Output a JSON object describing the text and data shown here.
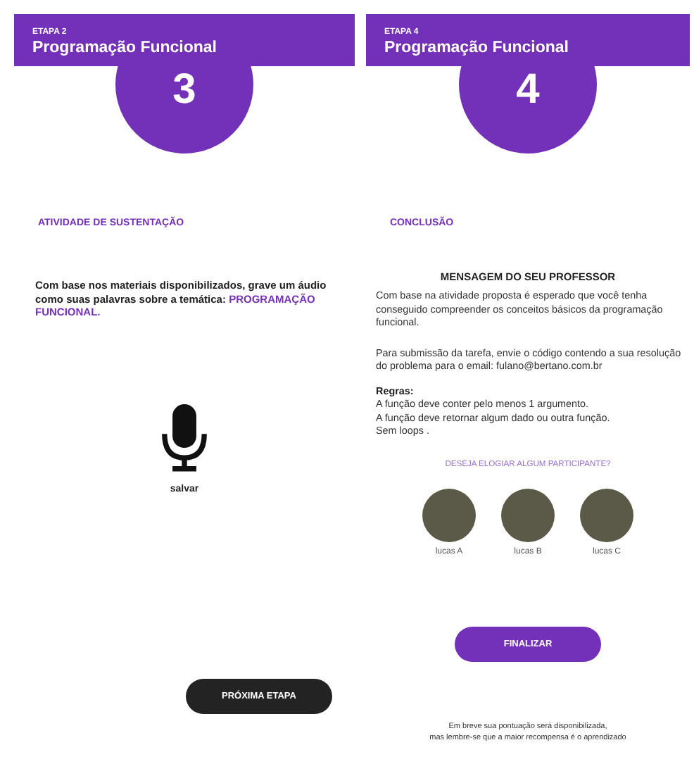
{
  "activity_screen": {
    "stage": "ETAPA 2",
    "title": "Programação Funcional",
    "step": "3",
    "section_title": "ATIVIDADE DE SUSTENTAÇÃO",
    "prompt": "Com base nos materiais disponibilizados, grave um áudio como suas palavras sobre a temática:",
    "prompt_highlight": "PROGRAMAÇÃO FUNCIONAL.",
    "record_label": "salvar",
    "next_button": "PRÓXIMA ETAPA"
  },
  "conclusion_screen": {
    "stage": "ETAPA 4",
    "title": "Programação Funcional",
    "step": "4",
    "section_title": "CONCLUSÃO",
    "message_title": "MENSAGEM DO SEU PROFESSOR",
    "message_paragraphs": [
      "Com base na atividade proposta é esperado que você tenha conseguido compreender os conceitos básicos da programação funcional.",
      "Para submissão da tarefa, envie o código contendo a sua resolução do problema para o email: fulano@bertano.com.br"
    ],
    "rules_title": "Regras:",
    "rules": [
      "A função deve conter pelo menos 1 argumento.",
      "A função deve retornar algum dado ou outra função.",
      "Sem loops ."
    ],
    "praise_prompt": "DESEJA ELOGIAR ALGUM PARTICIPANTE?",
    "participants": [
      {
        "name": "lucas A"
      },
      {
        "name": "lucas B"
      },
      {
        "name": "lucas C"
      }
    ],
    "finish_button": "FINALIZAR",
    "footer_lines": [
      "Em breve sua pontuação será disponibilizada,",
      "mas lembre-se que a maior recompensa é o aprendizado"
    ]
  }
}
